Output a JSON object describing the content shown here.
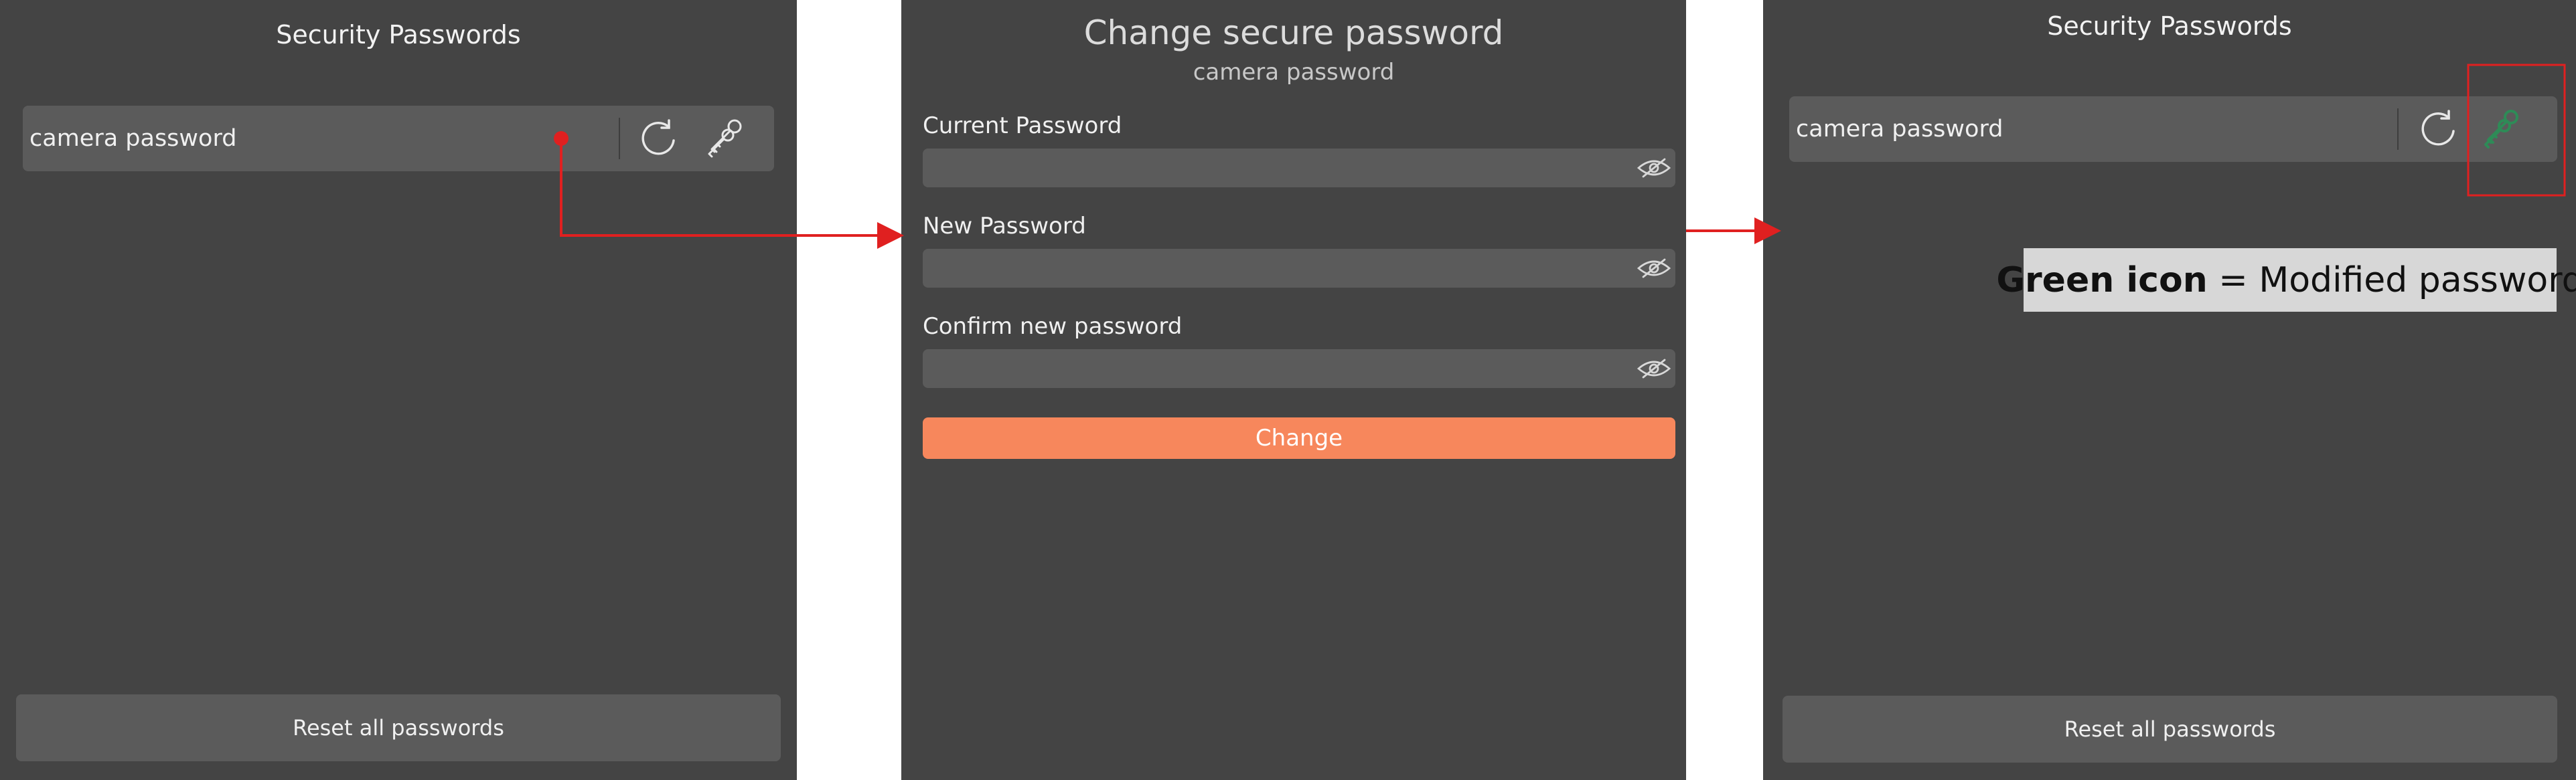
{
  "left_panel": {
    "title": "Security Passwords",
    "row_label": "camera password",
    "reset_label": "Reset all passwords",
    "icons": [
      "refresh-icon",
      "keys-icon"
    ]
  },
  "middle_panel": {
    "title": "Change secure password",
    "subtitle": "camera password",
    "fields": [
      {
        "label": "Current Password",
        "value": ""
      },
      {
        "label": "New Password",
        "value": ""
      },
      {
        "label": "Confirm new password",
        "value": ""
      }
    ],
    "change_label": "Change",
    "icons": [
      "eye-slash-icon"
    ]
  },
  "right_panel": {
    "title": "Security Passwords",
    "row_label": "camera password",
    "reset_label": "Reset all passwords",
    "icons": [
      "refresh-icon",
      "keys-icon-modified"
    ]
  },
  "annotation": {
    "bold": "Green icon",
    "eq": " = ",
    "text": "Modified password"
  },
  "colors": {
    "panel_bg": "#444444",
    "row_bg": "#5b5b5b",
    "accent_orange": "#f7875c",
    "modified_green": "#2e8b57",
    "annotation_red": "#e02020"
  }
}
